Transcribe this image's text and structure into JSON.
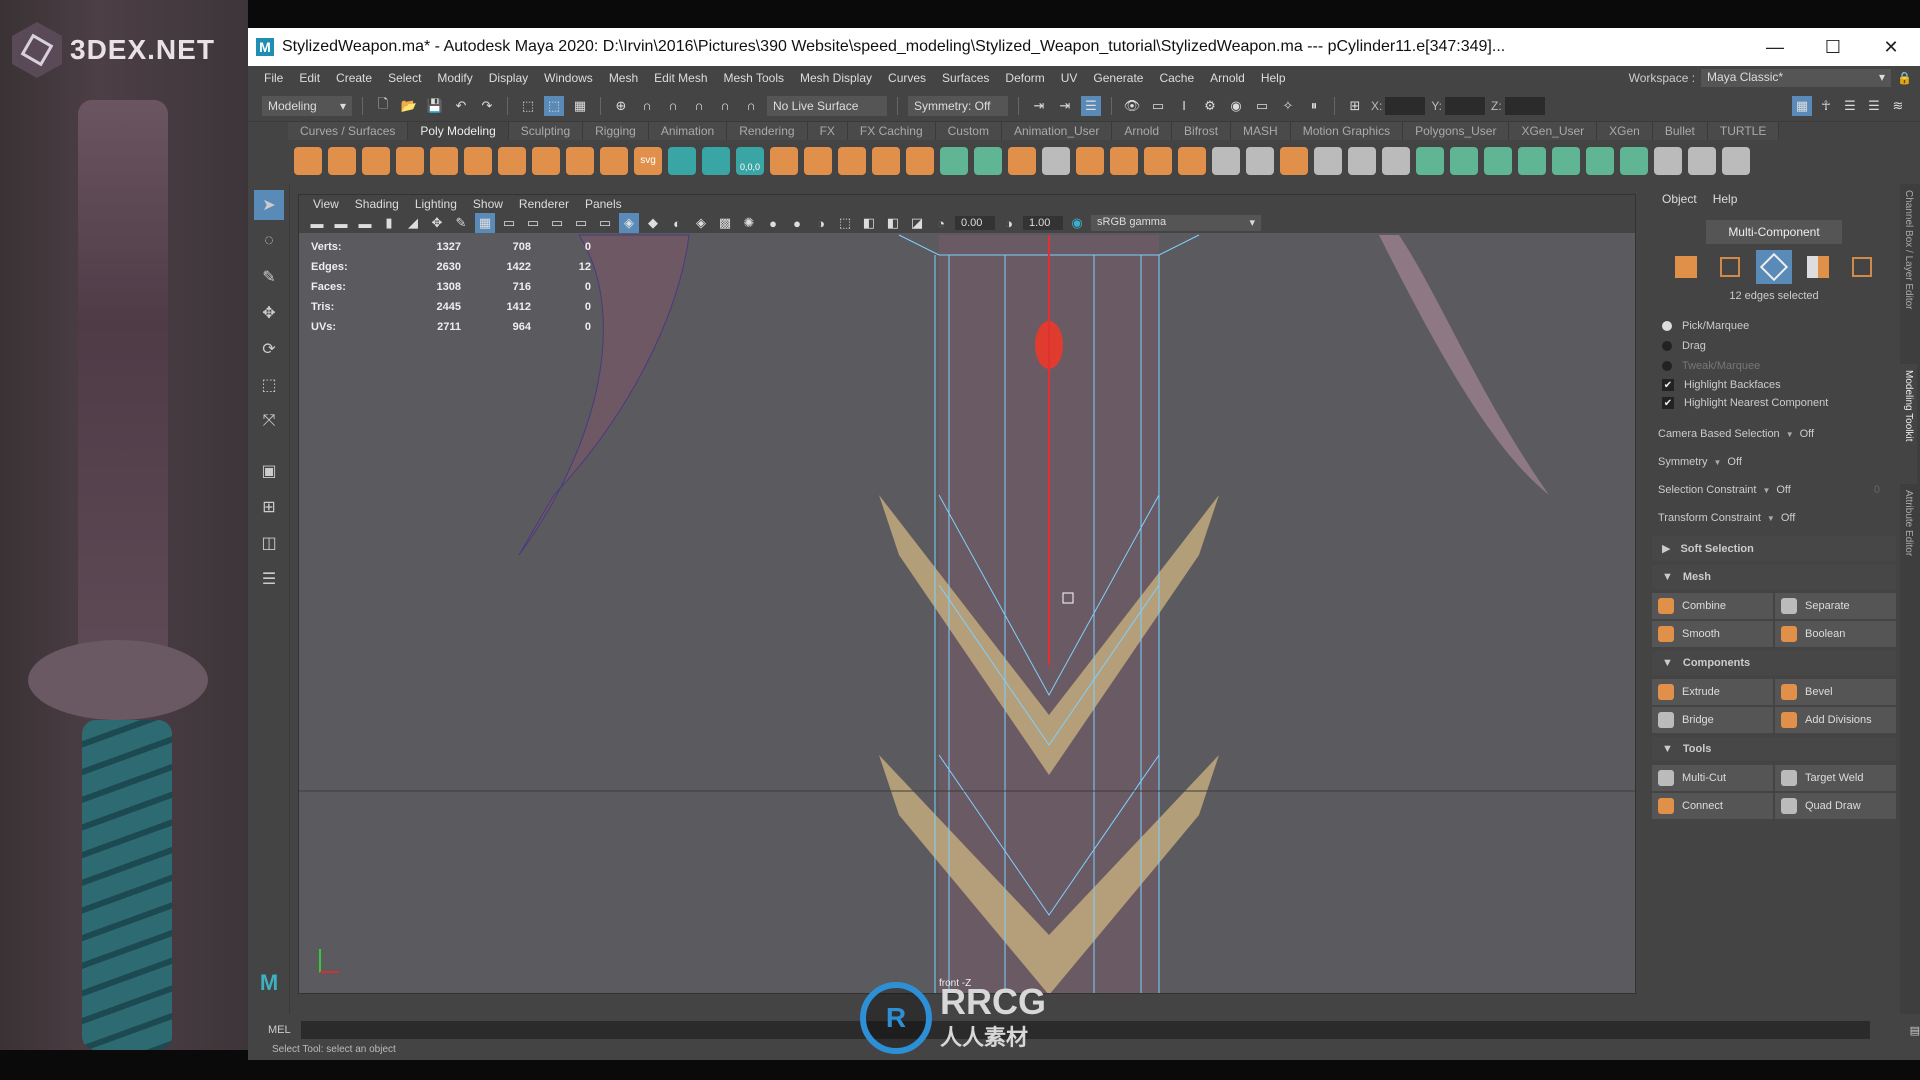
{
  "branding": {
    "logo_text": "3DEX.NET",
    "watermark_main": "RRCG",
    "watermark_sub": "人人素材"
  },
  "window": {
    "app_icon": "M",
    "title": "StylizedWeapon.ma* - Autodesk Maya 2020: D:\\Irvin\\2016\\Pictures\\390 Website\\speed_modeling\\Stylized_Weapon_tutorial\\StylizedWeapon.ma   ---   pCylinder11.e[347:349]...",
    "minimize_icon": "—",
    "maximize_icon": "☐",
    "close_icon": "✕"
  },
  "menubar": {
    "items": [
      "File",
      "Edit",
      "Create",
      "Select",
      "Modify",
      "Display",
      "Windows",
      "Mesh",
      "Edit Mesh",
      "Mesh Tools",
      "Mesh Display",
      "Curves",
      "Surfaces",
      "Deform",
      "UV",
      "Generate",
      "Cache",
      "Arnold",
      "Help"
    ],
    "workspace_label": "Workspace :",
    "workspace_value": "Maya Classic*"
  },
  "statusline": {
    "menuset": "Modeling",
    "live_surface": "No Live Surface",
    "symmetry": "Symmetry: Off",
    "x_label": "X:",
    "y_label": "Y:",
    "z_label": "Z:"
  },
  "shelf": {
    "tabs": [
      "Curves / Surfaces",
      "Poly Modeling",
      "Sculpting",
      "Rigging",
      "Animation",
      "Rendering",
      "FX",
      "FX Caching",
      "Custom",
      "Animation_User",
      "Arnold",
      "Bifrost",
      "MASH",
      "Motion Graphics",
      "Polygons_User",
      "XGen_User",
      "XGen",
      "Bullet",
      "TURTLE"
    ],
    "active_tab": "Poly Modeling",
    "svg_label": "svg",
    "zero_label": "0,0,0"
  },
  "viewport": {
    "menu": [
      "View",
      "Shading",
      "Lighting",
      "Show",
      "Renderer",
      "Panels"
    ],
    "exposure": "0.00",
    "gamma_value": "1.00",
    "color_space": "sRGB gamma",
    "camera": "front -Z",
    "hud": [
      {
        "label": "Verts:",
        "a": "1327",
        "b": "708",
        "c": "0"
      },
      {
        "label": "Edges:",
        "a": "2630",
        "b": "1422",
        "c": "12"
      },
      {
        "label": "Faces:",
        "a": "1308",
        "b": "716",
        "c": "0"
      },
      {
        "label": "Tris:",
        "a": "2445",
        "b": "1412",
        "c": "0"
      },
      {
        "label": "UVs:",
        "a": "2711",
        "b": "964",
        "c": "0"
      }
    ]
  },
  "toolkit": {
    "menu": [
      "Object",
      "Help"
    ],
    "mode_button": "Multi-Component",
    "selection_count": "12 edges selected",
    "radios": [
      {
        "label": "Pick/Marquee",
        "selected": true,
        "enabled": true
      },
      {
        "label": "Drag",
        "selected": false,
        "enabled": true
      },
      {
        "label": "Tweak/Marquee",
        "selected": false,
        "enabled": false
      }
    ],
    "checks": [
      {
        "label": "Highlight Backfaces",
        "checked": true
      },
      {
        "label": "Highlight Nearest Component",
        "checked": true
      }
    ],
    "options": [
      {
        "label": "Camera Based Selection",
        "value": "Off"
      },
      {
        "label": "Symmetry",
        "value": "Off"
      },
      {
        "label": "Selection Constraint",
        "value": "Off",
        "extra": "0"
      },
      {
        "label": "Transform Constraint",
        "value": "Off"
      }
    ],
    "soft_selection": "Soft Selection",
    "sections": [
      {
        "title": "Mesh",
        "buttons": [
          "Combine",
          "Separate",
          "Smooth",
          "Boolean"
        ]
      },
      {
        "title": "Components",
        "buttons": [
          "Extrude",
          "Bevel",
          "Bridge",
          "Add Divisions"
        ]
      },
      {
        "title": "Tools",
        "buttons": [
          "Multi-Cut",
          "Target Weld",
          "Connect",
          "Quad Draw"
        ]
      }
    ],
    "side_tabs": [
      "Channel Box / Layer Editor",
      "Modeling Toolkit",
      "Attribute Editor"
    ]
  },
  "commandline": {
    "lang": "MEL",
    "help": "Select Tool: select an object"
  },
  "colors": {
    "accent": "#5a8ab8",
    "shelf_orange": "#e0904a",
    "shelf_green": "#5fb594",
    "edge_selected": "#e03030",
    "wireframe": "#7fd0ff"
  }
}
